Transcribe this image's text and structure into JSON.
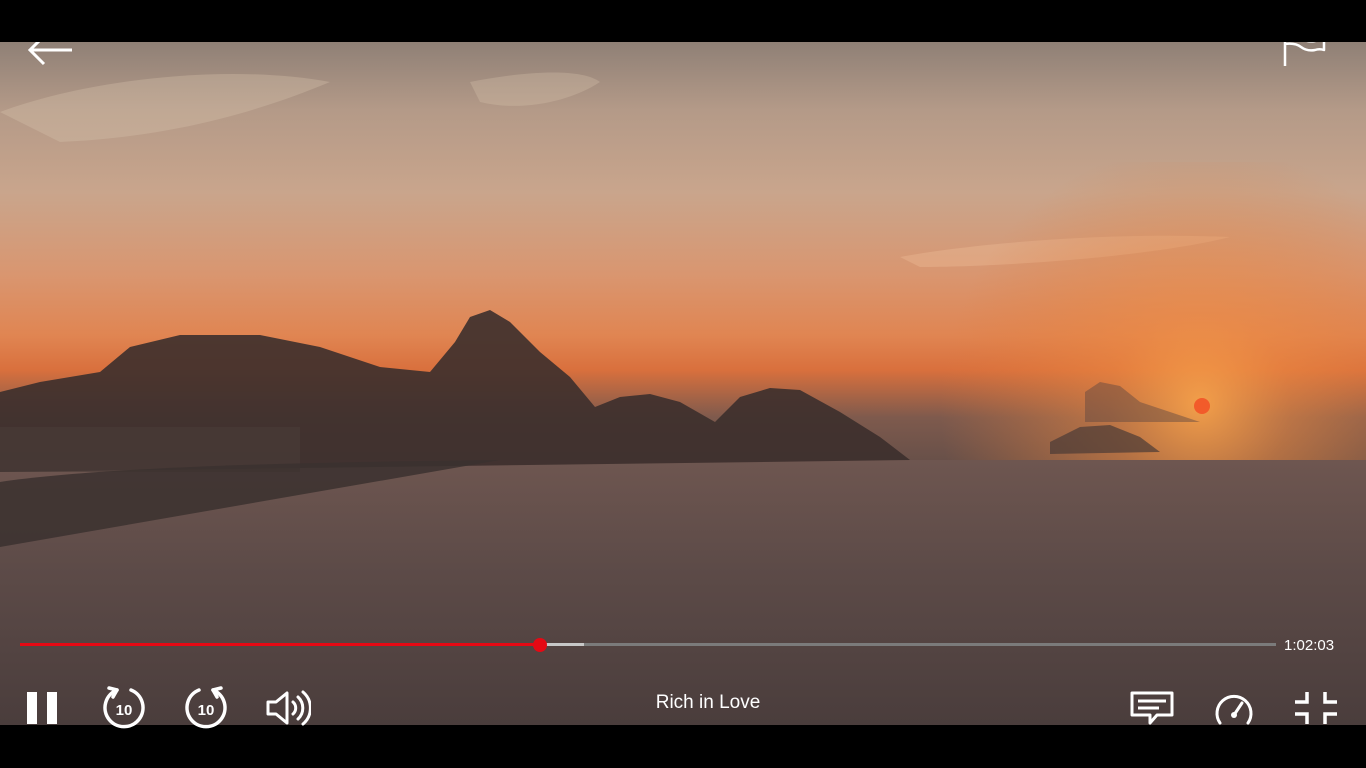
{
  "video": {
    "title": "Rich in Love",
    "time_remaining": "1:02:03",
    "progress_fraction": 0.414,
    "buffered_fraction": 0.449
  },
  "colors": {
    "accent": "#e50914",
    "track": "#7b7b7b",
    "buffer": "#c8c8c8",
    "icon": "#ffffff"
  },
  "top_bar": {
    "back_icon": "arrow-left-icon",
    "report_icon": "flag-icon"
  },
  "controls": {
    "left": [
      {
        "name": "pause-button",
        "icon": "pause-icon"
      },
      {
        "name": "rewind-10-button",
        "icon": "rewind-10-icon",
        "label": "10"
      },
      {
        "name": "forward-10-button",
        "icon": "forward-10-icon",
        "label": "10"
      },
      {
        "name": "volume-button",
        "icon": "volume-icon"
      }
    ],
    "right": [
      {
        "name": "subtitles-button",
        "icon": "subtitles-icon"
      },
      {
        "name": "playback-speed-button",
        "icon": "speedometer-icon"
      },
      {
        "name": "exit-fullscreen-button",
        "icon": "exit-fullscreen-icon"
      }
    ]
  }
}
